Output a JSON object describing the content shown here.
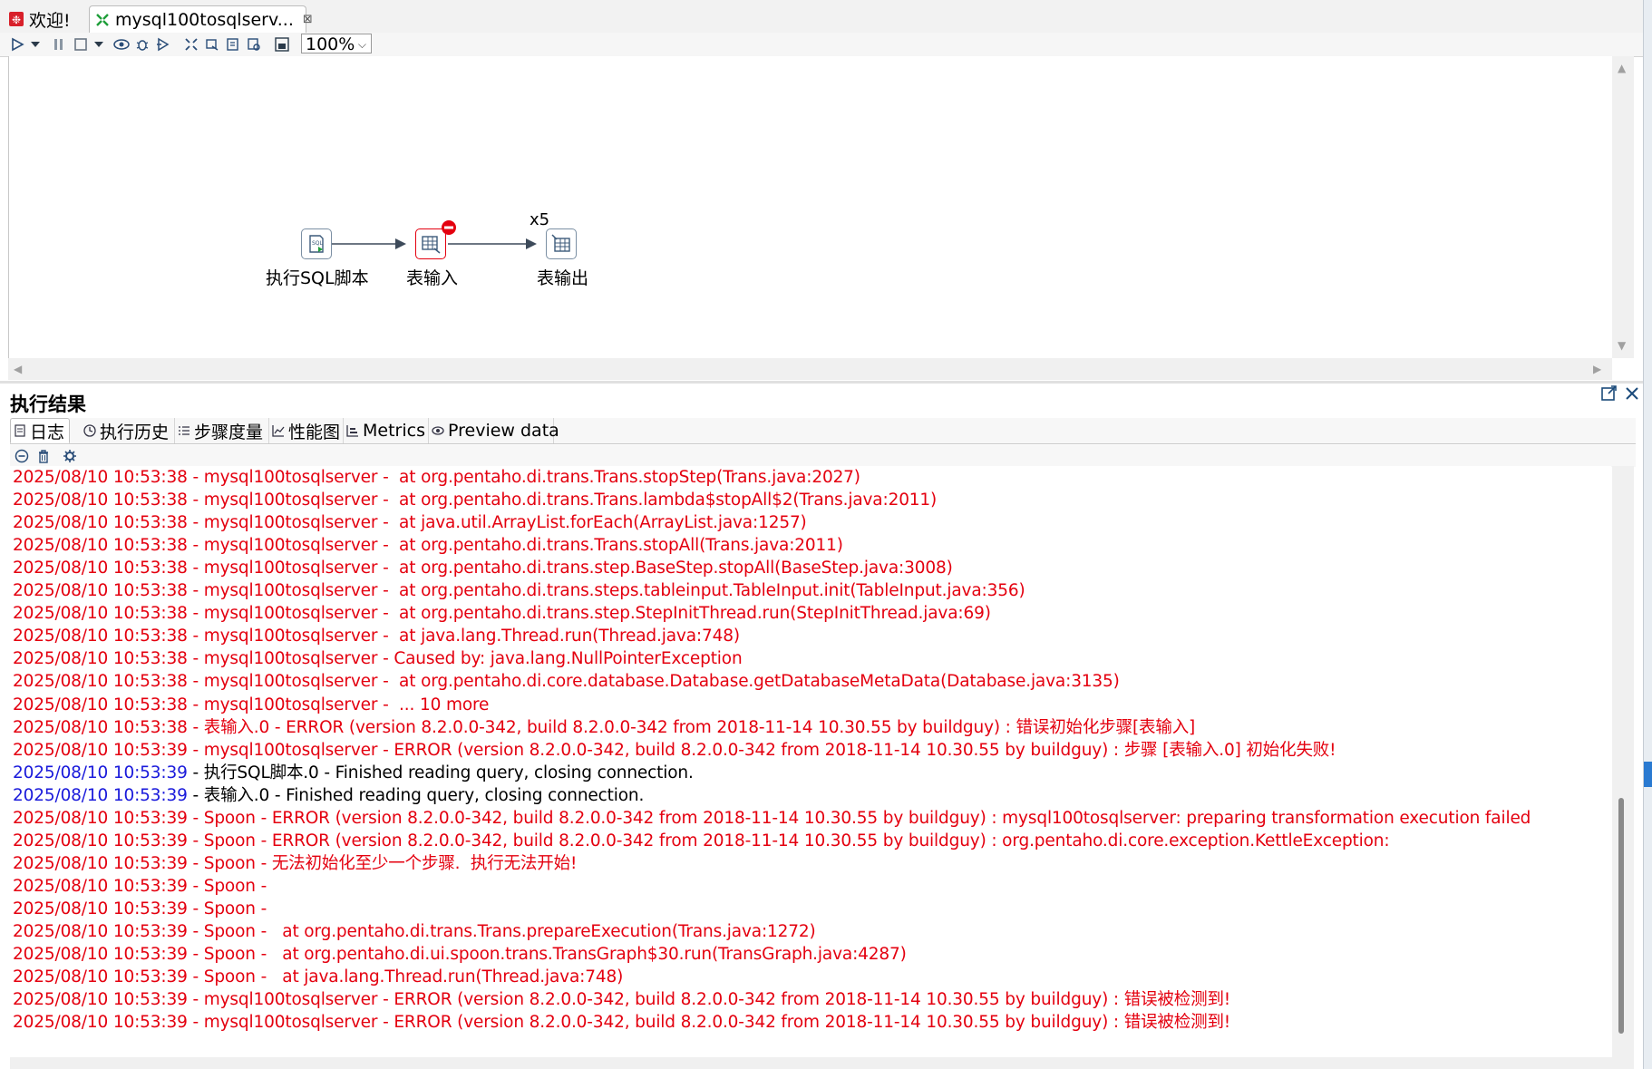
{
  "tabs": [
    {
      "label": "欢迎!"
    },
    {
      "label": "mysql100tosqlserv...",
      "close": "⊠"
    }
  ],
  "toolbar": {
    "zoom": "100%"
  },
  "canvas": {
    "steps": [
      {
        "label": "执行SQL脚本",
        "icon": "sql-script-icon"
      },
      {
        "label": "表输入",
        "icon": "table-input-icon",
        "error": true
      },
      {
        "label": "表输出",
        "icon": "table-output-icon",
        "copies": "x5"
      }
    ]
  },
  "results": {
    "title": "执行结果",
    "tabs": [
      {
        "label": "日志",
        "icon": "log-icon"
      },
      {
        "label": "执行历史",
        "icon": "history-icon"
      },
      {
        "label": "步骤度量",
        "icon": "metrics-list-icon"
      },
      {
        "label": "性能图",
        "icon": "chart-icon"
      },
      {
        "label": "Metrics",
        "icon": "metrics-icon"
      },
      {
        "label": "Preview data",
        "icon": "preview-eye-icon"
      }
    ]
  },
  "log": {
    "lines": [
      {
        "ts": "2025/08/10 10:53:38",
        "text": " - mysql100tosqlserver -  at org.pentaho.di.trans.Trans.stopStep(Trans.java:2027)",
        "ts_color": "red",
        "text_color": "red"
      },
      {
        "ts": "2025/08/10 10:53:38",
        "text": " - mysql100tosqlserver -  at org.pentaho.di.trans.Trans.lambda$stopAll$2(Trans.java:2011)",
        "ts_color": "red",
        "text_color": "red"
      },
      {
        "ts": "2025/08/10 10:53:38",
        "text": " - mysql100tosqlserver -  at java.util.ArrayList.forEach(ArrayList.java:1257)",
        "ts_color": "red",
        "text_color": "red"
      },
      {
        "ts": "2025/08/10 10:53:38",
        "text": " - mysql100tosqlserver -  at org.pentaho.di.trans.Trans.stopAll(Trans.java:2011)",
        "ts_color": "red",
        "text_color": "red"
      },
      {
        "ts": "2025/08/10 10:53:38",
        "text": " - mysql100tosqlserver -  at org.pentaho.di.trans.step.BaseStep.stopAll(BaseStep.java:3008)",
        "ts_color": "red",
        "text_color": "red"
      },
      {
        "ts": "2025/08/10 10:53:38",
        "text": " - mysql100tosqlserver -  at org.pentaho.di.trans.steps.tableinput.TableInput.init(TableInput.java:356)",
        "ts_color": "red",
        "text_color": "red"
      },
      {
        "ts": "2025/08/10 10:53:38",
        "text": " - mysql100tosqlserver -  at org.pentaho.di.trans.step.StepInitThread.run(StepInitThread.java:69)",
        "ts_color": "red",
        "text_color": "red"
      },
      {
        "ts": "2025/08/10 10:53:38",
        "text": " - mysql100tosqlserver -  at java.lang.Thread.run(Thread.java:748)",
        "ts_color": "red",
        "text_color": "red"
      },
      {
        "ts": "2025/08/10 10:53:38",
        "text": " - mysql100tosqlserver - Caused by: java.lang.NullPointerException",
        "ts_color": "red",
        "text_color": "red"
      },
      {
        "ts": "2025/08/10 10:53:38",
        "text": " - mysql100tosqlserver -  at org.pentaho.di.core.database.Database.getDatabaseMetaData(Database.java:3135)",
        "ts_color": "red",
        "text_color": "red"
      },
      {
        "ts": "2025/08/10 10:53:38",
        "text": " - mysql100tosqlserver -  ... 10 more",
        "ts_color": "red",
        "text_color": "red"
      },
      {
        "ts": "2025/08/10 10:53:38",
        "text": " - 表输入.0 - ERROR (version 8.2.0.0-342, build 8.2.0.0-342 from 2018-11-14 10.30.55 by buildguy) : 错误初始化步骤[表输入]",
        "ts_color": "red",
        "text_color": "red"
      },
      {
        "ts": "2025/08/10 10:53:39",
        "text": " - mysql100tosqlserver - ERROR (version 8.2.0.0-342, build 8.2.0.0-342 from 2018-11-14 10.30.55 by buildguy) : 步骤 [表输入.0] 初始化失败!",
        "ts_color": "red",
        "text_color": "red"
      },
      {
        "ts": "2025/08/10 10:53:39",
        "text": " - 执行SQL脚本.0 - Finished reading query, closing connection.",
        "ts_color": "blue",
        "text_color": "blk"
      },
      {
        "ts": "2025/08/10 10:53:39",
        "text": " - 表输入.0 - Finished reading query, closing connection.",
        "ts_color": "blue",
        "text_color": "blk"
      },
      {
        "ts": "2025/08/10 10:53:39",
        "text": " - Spoon - ERROR (version 8.2.0.0-342, build 8.2.0.0-342 from 2018-11-14 10.30.55 by buildguy) : mysql100tosqlserver: preparing transformation execution failed",
        "ts_color": "red",
        "text_color": "red"
      },
      {
        "ts": "2025/08/10 10:53:39",
        "text": " - Spoon - ERROR (version 8.2.0.0-342, build 8.2.0.0-342 from 2018-11-14 10.30.55 by buildguy) : org.pentaho.di.core.exception.KettleException:",
        "ts_color": "red",
        "text_color": "red"
      },
      {
        "ts": "2025/08/10 10:53:39",
        "text": " - Spoon - 无法初始化至少一个步骤.  执行无法开始!",
        "ts_color": "red",
        "text_color": "red"
      },
      {
        "ts": "2025/08/10 10:53:39",
        "text": " - Spoon - ",
        "ts_color": "red",
        "text_color": "red"
      },
      {
        "ts": "2025/08/10 10:53:39",
        "text": " - Spoon - ",
        "ts_color": "red",
        "text_color": "red"
      },
      {
        "ts": "2025/08/10 10:53:39",
        "text": " - Spoon -   at org.pentaho.di.trans.Trans.prepareExecution(Trans.java:1272)",
        "ts_color": "red",
        "text_color": "red"
      },
      {
        "ts": "2025/08/10 10:53:39",
        "text": " - Spoon -   at org.pentaho.di.ui.spoon.trans.TransGraph$30.run(TransGraph.java:4287)",
        "ts_color": "red",
        "text_color": "red"
      },
      {
        "ts": "2025/08/10 10:53:39",
        "text": " - Spoon -   at java.lang.Thread.run(Thread.java:748)",
        "ts_color": "red",
        "text_color": "red"
      },
      {
        "ts": "2025/08/10 10:53:39",
        "text": " - mysql100tosqlserver - ERROR (version 8.2.0.0-342, build 8.2.0.0-342 from 2018-11-14 10.30.55 by buildguy) : 错误被检测到!",
        "ts_color": "red",
        "text_color": "red"
      },
      {
        "ts": "2025/08/10 10:53:39",
        "text": " - mysql100tosqlserver - ERROR (version 8.2.0.0-342, build 8.2.0.0-342 from 2018-11-14 10.30.55 by buildguy) : 错误被检测到!",
        "ts_color": "red",
        "text_color": "red"
      }
    ]
  },
  "colors": {
    "error": "#e4000f",
    "info_ts": "#1a1adb",
    "hop": "#3d4a5a"
  }
}
